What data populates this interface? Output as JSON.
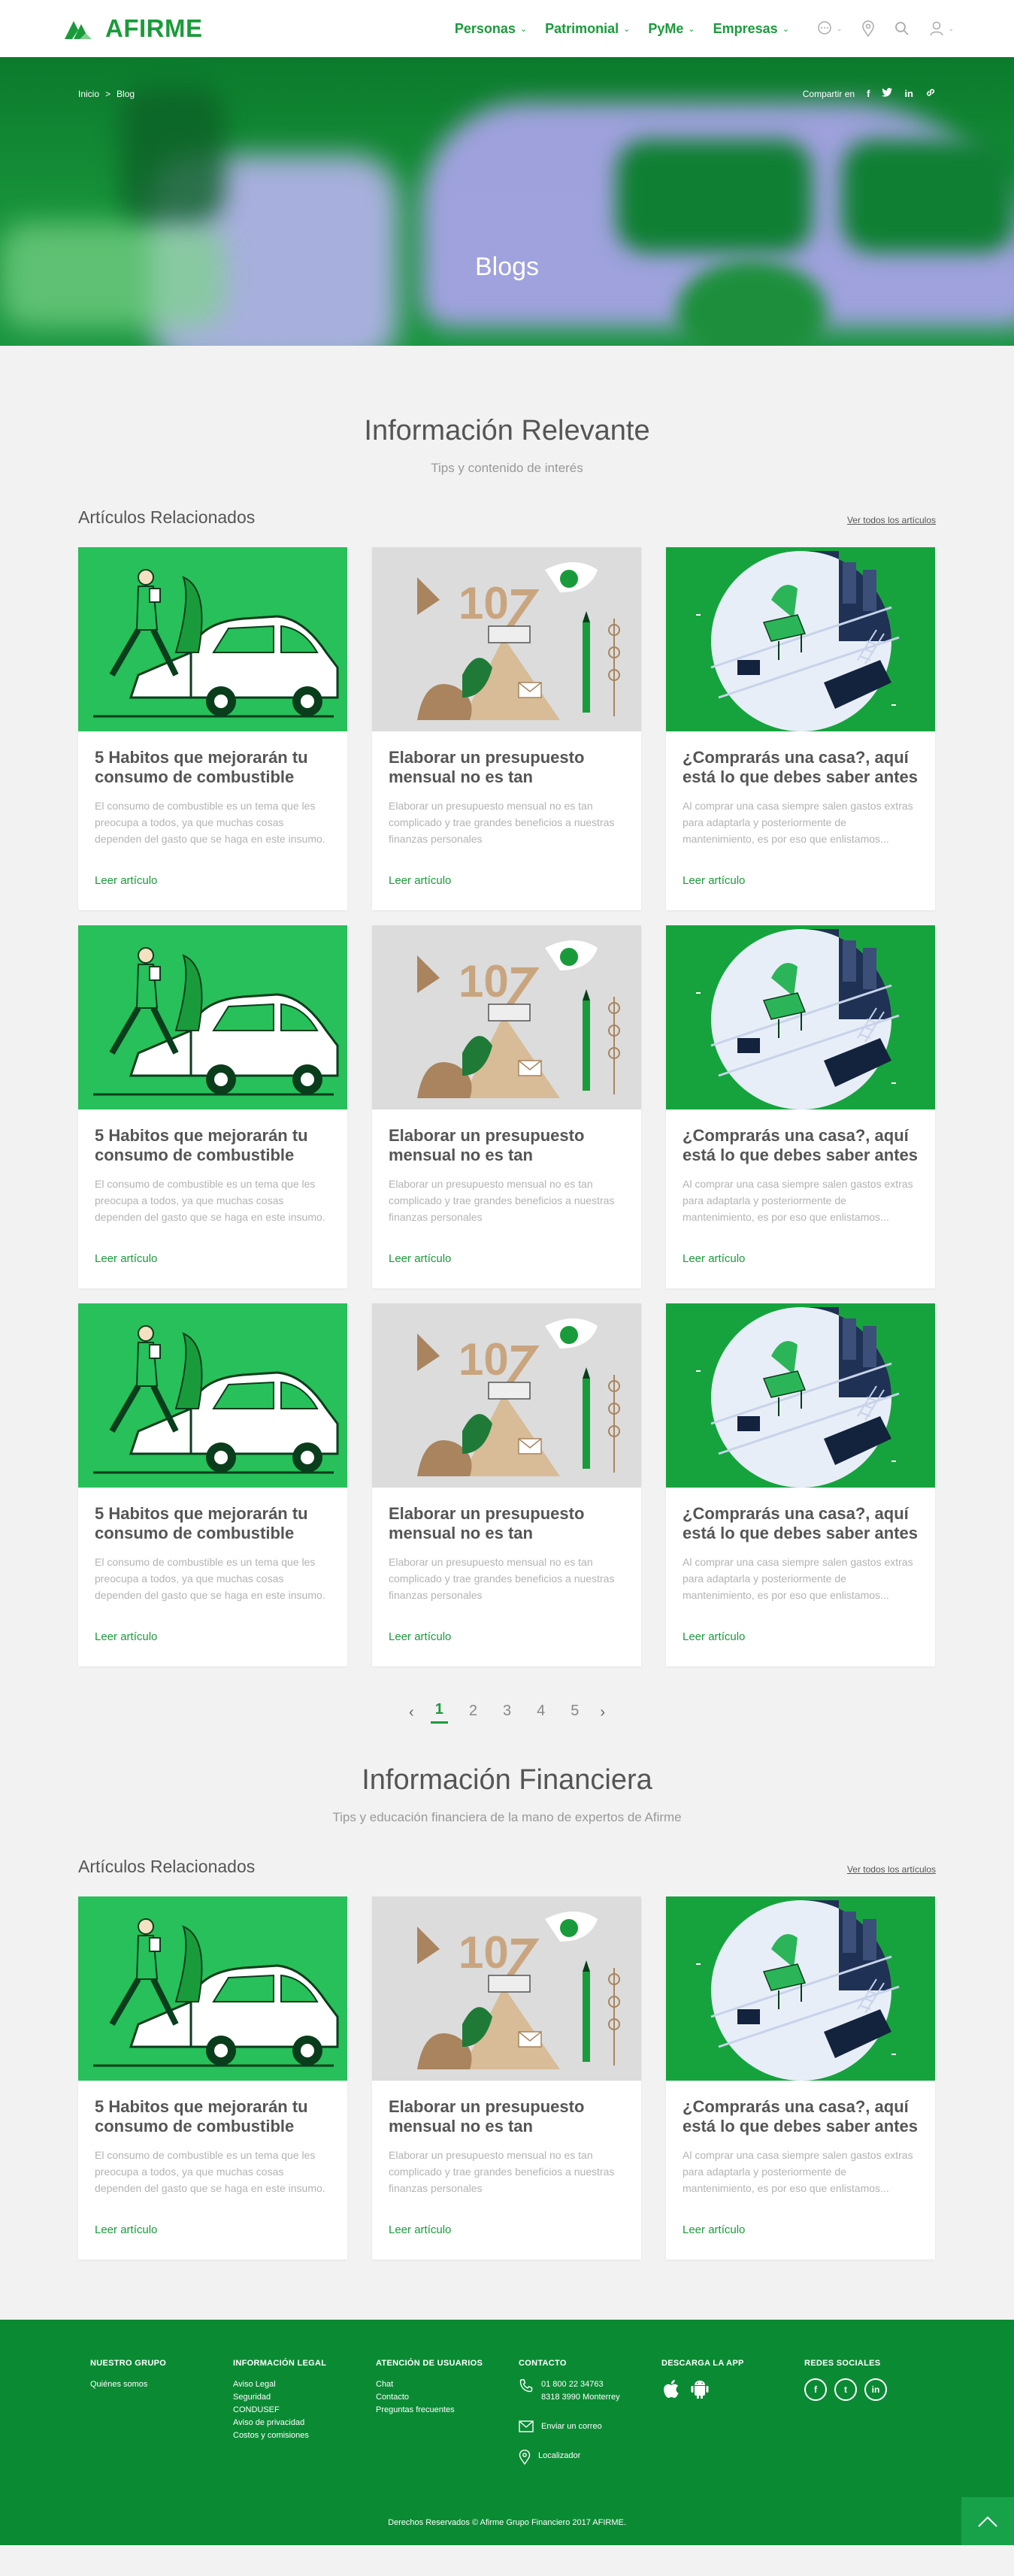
{
  "header": {
    "brand": "AFIRME",
    "nav": [
      {
        "label": "Personas"
      },
      {
        "label": "Patrimonial"
      },
      {
        "label": "PyMe"
      },
      {
        "label": "Empresas"
      }
    ]
  },
  "hero": {
    "breadcrumb": [
      "Inicio",
      ">",
      "Blog"
    ],
    "share_label": "Compartir en",
    "share_icons": [
      "f",
      "t",
      "in",
      "link"
    ],
    "title": "Blogs"
  },
  "sections": [
    {
      "title": "Información Relevante",
      "subtitle": "Tips y contenido de interés",
      "related_title": "Artículos Relacionados",
      "see_all": "Ver todos los artículos"
    },
    {
      "title": "Información Financiera",
      "subtitle": "Tips y educación financiera de la mano de expertos de Afirme",
      "related_title": "Artículos Relacionados",
      "see_all": "Ver todos los artículos"
    }
  ],
  "articles": [
    {
      "title": "5 Habitos que mejorarán tu consumo de combustible",
      "desc": "El consumo de combustible es un tema que les preocupa a todos, ya que muchas cosas dependen del gasto que se haga en este insumo.",
      "link": "Leer artículo",
      "image": "car-illustration"
    },
    {
      "title": "Elaborar un presupuesto mensual no es tan complicado",
      "desc": "Elaborar un presupuesto mensual no es tan complicado y trae grandes beneficios a nuestras finanzas personales",
      "link": "Leer artículo",
      "image": "budget-illustration"
    },
    {
      "title": "¿Comprarás una casa?, aquí está lo que debes saber antes",
      "desc": "Al comprar una casa siempre salen gastos extras para adaptarla y posteriormente de mantenimiento, es por eso que enlistamos...",
      "link": "Leer artículo",
      "image": "house-illustration"
    }
  ],
  "pagination": {
    "pages": [
      "1",
      "2",
      "3",
      "4",
      "5"
    ],
    "active": "1",
    "prev": "‹",
    "next": "›"
  },
  "footer": {
    "grupo": {
      "heading": "NUESTRO GRUPO",
      "links": [
        "Quiénes somos"
      ]
    },
    "legal": {
      "heading": "INFORMACIÓN LEGAL",
      "links": [
        "Aviso Legal",
        "Seguridad",
        "CONDUSEF",
        "Aviso de privacidad",
        "Costos y comisiones"
      ]
    },
    "usuarios": {
      "heading": "ATENCIÓN DE USUARIOS",
      "links": [
        "Chat",
        "Contacto",
        "Preguntas frecuentes"
      ]
    },
    "contacto": {
      "heading": "CONTACTO",
      "phone1": "01 800 22 34763",
      "phone2": "8318 3990 Monterrey",
      "email": "Enviar un correo",
      "locator": "Localizador"
    },
    "app": {
      "heading": "DESCARGA LA APP"
    },
    "redes": {
      "heading": "REDES SOCIALES",
      "icons": [
        "f",
        "t",
        "in"
      ]
    },
    "copyright": "Derechos Reservados © Afirme Grupo Financiero 2017 AFIRME."
  },
  "colors": {
    "brand": "#1a9b3b",
    "footer": "#0b8a34",
    "hero": "#18933b"
  }
}
